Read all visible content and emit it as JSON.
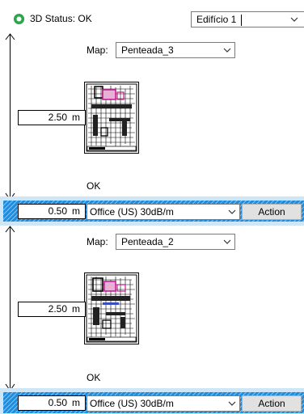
{
  "header": {
    "status_text": "3D Status: OK",
    "building_value": "Edifício 1",
    "status_icon": "green-status-circle-icon"
  },
  "levels": [
    {
      "map_label": "Map:",
      "map_value": "Penteada_3",
      "height_value": "2.50",
      "height_unit": "m",
      "status": "OK",
      "floor_value": "0.50",
      "floor_unit": "m",
      "material_value": "Office (US) 30dB/m",
      "action_label": "Action"
    },
    {
      "map_label": "Map:",
      "map_value": "Penteada_2",
      "height_value": "2.50",
      "height_unit": "m",
      "status": "OK",
      "floor_value": "0.50",
      "floor_unit": "m",
      "material_value": "Office (US) 30dB/m",
      "action_label": "Action"
    }
  ],
  "colors": {
    "slab_blue": "#1d8de0",
    "slab_light": "#cfe6f7",
    "status_green": "#2ea44f"
  }
}
